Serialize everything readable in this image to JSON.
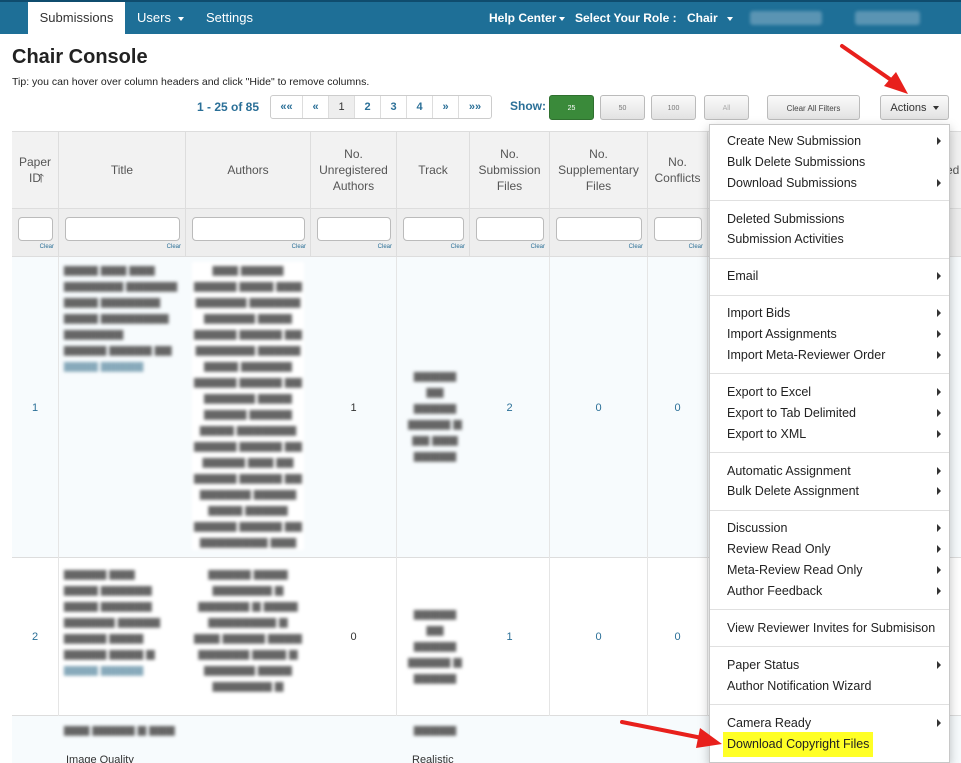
{
  "nav": {
    "tabs": [
      {
        "label": "Submissions"
      },
      {
        "label": "Users"
      },
      {
        "label": "Settings"
      }
    ],
    "help_center": "Help Center",
    "role_label": "Select Your Role :",
    "role_value": "Chair"
  },
  "page": {
    "title": "Chair Console",
    "tip": "Tip: you can hover over column headers and click \"Hide\" to remove columns."
  },
  "pager": {
    "info": "1 - 25 of 85",
    "buttons": [
      "««",
      "«",
      "1",
      "2",
      "3",
      "4",
      "»",
      "»»"
    ],
    "current": "1"
  },
  "show": {
    "label": "Show:",
    "options": [
      "25",
      "50",
      "100",
      "All"
    ],
    "selected": "25"
  },
  "toolbar": {
    "clear_filters": "Clear All Filters",
    "actions": "Actions"
  },
  "table": {
    "columns": [
      "Paper ID",
      "Title",
      "Authors",
      "No. Unregistered Authors",
      "Track",
      "No. Submission Files",
      "No. Supplementary Files",
      "No. Conflicts"
    ],
    "clear_label": "Clear",
    "partial_header_tail": "ed",
    "rows": [
      {
        "paper_id": "1",
        "unregistered": "1",
        "submission_files": "2",
        "supplementary_files": "0",
        "conflicts": "0"
      },
      {
        "paper_id": "2",
        "unregistered": "0",
        "submission_files": "1",
        "supplementary_files": "0",
        "conflicts": "0"
      }
    ],
    "row3_partial": {
      "title": "Image Quality",
      "track": "Realistic"
    }
  },
  "actions_menu": {
    "groups": [
      [
        {
          "label": "Create New Submission",
          "submenu": true
        },
        {
          "label": "Bulk Delete Submissions",
          "submenu": false
        },
        {
          "label": "Download Submissions",
          "submenu": true
        }
      ],
      [
        {
          "label": "Deleted Submissions",
          "submenu": false
        },
        {
          "label": "Submission Activities",
          "submenu": false
        }
      ],
      [
        {
          "label": "Email",
          "submenu": true
        }
      ],
      [
        {
          "label": "Import Bids",
          "submenu": true
        },
        {
          "label": "Import Assignments",
          "submenu": true
        },
        {
          "label": "Import Meta-Reviewer Order",
          "submenu": true
        }
      ],
      [
        {
          "label": "Export to Excel",
          "submenu": true
        },
        {
          "label": "Export to Tab Delimited",
          "submenu": true
        },
        {
          "label": "Export to XML",
          "submenu": true
        }
      ],
      [
        {
          "label": "Automatic Assignment",
          "submenu": true
        },
        {
          "label": "Bulk Delete Assignment",
          "submenu": true
        }
      ],
      [
        {
          "label": "Discussion",
          "submenu": true
        },
        {
          "label": "Review Read Only",
          "submenu": true
        },
        {
          "label": "Meta-Review Read Only",
          "submenu": true
        },
        {
          "label": "Author Feedback",
          "submenu": true
        }
      ],
      [
        {
          "label": "View Reviewer Invites for Submisison",
          "submenu": false
        }
      ],
      [
        {
          "label": "Paper Status",
          "submenu": true
        },
        {
          "label": "Author Notification Wizard",
          "submenu": false
        }
      ],
      [
        {
          "label": "Camera Ready",
          "submenu": true
        },
        {
          "label": "Download Copyright Files",
          "submenu": false,
          "highlighted": true
        }
      ]
    ]
  },
  "colors": {
    "nav_bg": "#1e6f97",
    "link": "#2a6f97",
    "show_selected": "#3a8a3a",
    "highlight": "#ffff26",
    "annotation_arrow": "#e8201c"
  }
}
